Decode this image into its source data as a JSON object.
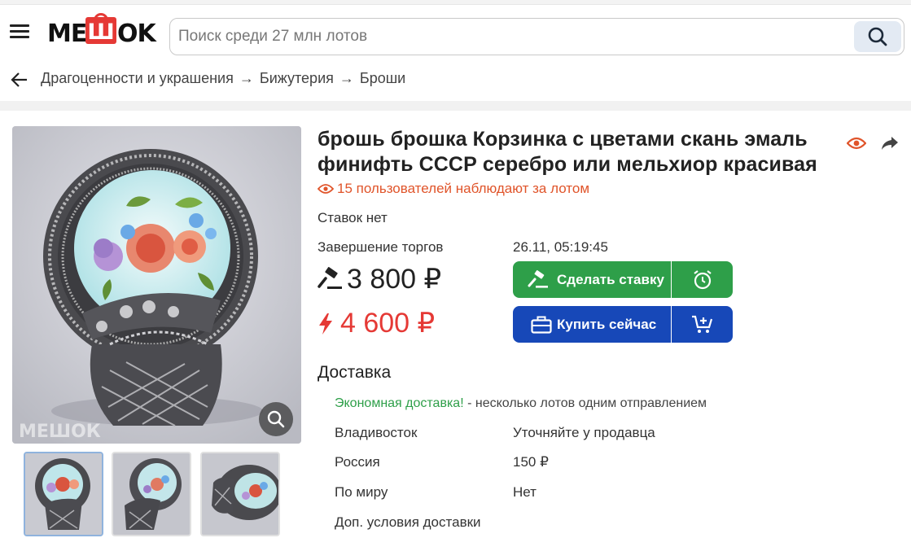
{
  "header": {
    "logo_text": "МЕШОК",
    "search_placeholder": "Поиск среди 27 млн лотов"
  },
  "breadcrumb": {
    "items": [
      "Драгоценности и украшения",
      "Бижутерия",
      "Броши"
    ],
    "separator": "→"
  },
  "lot": {
    "title": "брошь брошка Корзинка с цветами скань эмаль финифть СССР серебро или мельхиор красивая",
    "watchers_text": "15 пользователей наблюдают за лотом",
    "bids_status": "Ставок нет",
    "end_label": "Завершение торгов",
    "end_value": "26.11, 05:19:45",
    "current_price": "3 800 ₽",
    "buy_now_price": "4 600 ₽"
  },
  "buttons": {
    "bid_label": "Сделать ставку",
    "buy_label": "Купить сейчас"
  },
  "gallery": {
    "watermark": "МЕШОК",
    "thumbnail_count": 3,
    "selected_index": 0
  },
  "delivery": {
    "heading": "Доставка",
    "economy_link": "Экономная доставка!",
    "economy_text": " - несколько лотов одним отправлением",
    "rows": [
      {
        "label": "Владивосток",
        "value": "Уточняйте у продавца"
      },
      {
        "label": "Россия",
        "value": "150 ₽"
      },
      {
        "label": "По миру",
        "value": "Нет"
      },
      {
        "label": "Доп. условия доставки",
        "value": ""
      }
    ]
  },
  "colors": {
    "accent_green": "#2e9f49",
    "accent_blue": "#1748b8",
    "price_red": "#e53935",
    "watchers_orange": "#e0542a",
    "logo_red": "#e53935"
  },
  "icons": [
    "menu-icon",
    "search-icon",
    "back-arrow-icon",
    "eye-icon",
    "share-icon",
    "gavel-icon",
    "lightning-icon",
    "alarm-clock-icon",
    "briefcase-icon",
    "add-to-cart-icon",
    "zoom-icon"
  ]
}
